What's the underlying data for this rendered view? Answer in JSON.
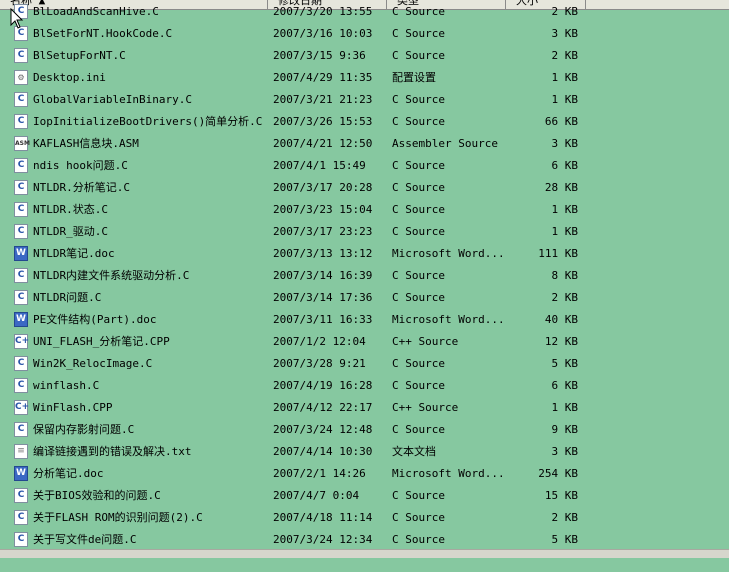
{
  "header": {
    "columns": [
      {
        "label": "名称 ▲"
      },
      {
        "label": "修改日期"
      },
      {
        "label": "类型"
      },
      {
        "label": "大小"
      }
    ]
  },
  "files": [
    {
      "name": "BlLoadAndScanHive.C",
      "date": "2007/3/20 13:55",
      "type": "C Source",
      "size": "2 KB",
      "icon": "c-file-icon"
    },
    {
      "name": "BlSetForNT.HookCode.C",
      "date": "2007/3/16 10:03",
      "type": "C Source",
      "size": "3 KB",
      "icon": "c-file-icon"
    },
    {
      "name": "BlSetupForNT.C",
      "date": "2007/3/15 9:36",
      "type": "C Source",
      "size": "2 KB",
      "icon": "c-file-icon"
    },
    {
      "name": "Desktop.ini",
      "date": "2007/4/29 11:35",
      "type": "配置设置",
      "size": "1 KB",
      "icon": "settings-file-icon"
    },
    {
      "name": "GlobalVariableInBinary.C",
      "date": "2007/3/21 21:23",
      "type": "C Source",
      "size": "1 KB",
      "icon": "c-file-icon"
    },
    {
      "name": "IopInitializeBootDrivers()简单分析.C",
      "date": "2007/3/26 15:53",
      "type": "C Source",
      "size": "66 KB",
      "icon": "c-file-icon"
    },
    {
      "name": "KAFLASH信息块.ASM",
      "date": "2007/4/21 12:50",
      "type": "Assembler Source",
      "size": "3 KB",
      "icon": "asm-file-icon"
    },
    {
      "name": "ndis hook问题.C",
      "date": "2007/4/1 15:49",
      "type": "C Source",
      "size": "6 KB",
      "icon": "c-file-icon"
    },
    {
      "name": "NTLDR.分析笔记.C",
      "date": "2007/3/17 20:28",
      "type": "C Source",
      "size": "28 KB",
      "icon": "c-file-icon"
    },
    {
      "name": "NTLDR.状态.C",
      "date": "2007/3/23 15:04",
      "type": "C Source",
      "size": "1 KB",
      "icon": "c-file-icon"
    },
    {
      "name": "NTLDR_驱动.C",
      "date": "2007/3/17 23:23",
      "type": "C Source",
      "size": "1 KB",
      "icon": "c-file-icon"
    },
    {
      "name": "NTLDR笔记.doc",
      "date": "2007/3/13 13:12",
      "type": "Microsoft Word...",
      "size": "111 KB",
      "icon": "word-file-icon"
    },
    {
      "name": "NTLDR内建文件系统驱动分析.C",
      "date": "2007/3/14 16:39",
      "type": "C Source",
      "size": "8 KB",
      "icon": "c-file-icon"
    },
    {
      "name": "NTLDR问题.C",
      "date": "2007/3/14 17:36",
      "type": "C Source",
      "size": "2 KB",
      "icon": "c-file-icon"
    },
    {
      "name": "PE文件结构(Part).doc",
      "date": "2007/3/11 16:33",
      "type": "Microsoft Word...",
      "size": "40 KB",
      "icon": "word-file-icon"
    },
    {
      "name": "UNI_FLASH_分析笔记.CPP",
      "date": "2007/1/2 12:04",
      "type": "C++ Source",
      "size": "12 KB",
      "icon": "cpp-file-icon"
    },
    {
      "name": "Win2K_RelocImage.C",
      "date": "2007/3/28 9:21",
      "type": "C Source",
      "size": "5 KB",
      "icon": "c-file-icon"
    },
    {
      "name": "winflash.C",
      "date": "2007/4/19 16:28",
      "type": "C Source",
      "size": "6 KB",
      "icon": "c-file-icon"
    },
    {
      "name": "WinFlash.CPP",
      "date": "2007/4/12 22:17",
      "type": "C++ Source",
      "size": "1 KB",
      "icon": "cpp-file-icon"
    },
    {
      "name": "保留内存影射问题.C",
      "date": "2007/3/24 12:48",
      "type": "C Source",
      "size": "9 KB",
      "icon": "c-file-icon"
    },
    {
      "name": "编译链接遇到的错误及解决.txt",
      "date": "2007/4/14 10:30",
      "type": "文本文档",
      "size": "3 KB",
      "icon": "text-file-icon"
    },
    {
      "name": "分析笔记.doc",
      "date": "2007/2/1 14:26",
      "type": "Microsoft Word...",
      "size": "254 KB",
      "icon": "word-file-icon"
    },
    {
      "name": "关于BIOS效验和的问题.C",
      "date": "2007/4/7 0:04",
      "type": "C Source",
      "size": "15 KB",
      "icon": "c-file-icon"
    },
    {
      "name": "关于FLASH ROM的识别问题(2).C",
      "date": "2007/4/18 11:14",
      "type": "C Source",
      "size": "2 KB",
      "icon": "c-file-icon"
    },
    {
      "name": "关于写文件de问题.C",
      "date": "2007/3/24 12:34",
      "type": "C Source",
      "size": "5 KB",
      "icon": "c-file-icon"
    }
  ],
  "colors": {
    "background": "#86c8a0",
    "header": "#e6e6dc"
  }
}
